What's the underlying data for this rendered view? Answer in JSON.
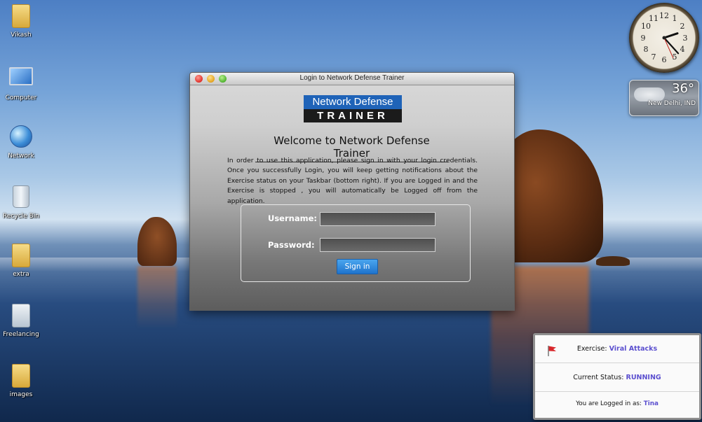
{
  "desktop": {
    "icons": [
      {
        "label": "Vikash",
        "icon": "user-folder-icon"
      },
      {
        "label": "Computer",
        "icon": "computer-icon"
      },
      {
        "label": "Network",
        "icon": "network-icon"
      },
      {
        "label": "Recycle Bin",
        "icon": "recycle-bin-icon"
      },
      {
        "label": "extra",
        "icon": "folder-icon"
      },
      {
        "label": "Freelancing",
        "icon": "folder-shortcut-icon"
      },
      {
        "label": "images",
        "icon": "folder-icon"
      }
    ]
  },
  "gadgets": {
    "clock": {
      "hours": 2,
      "minutes": 23,
      "seconds": 26
    },
    "weather": {
      "temperature": "36°",
      "city": "New Delhi, IND"
    }
  },
  "window": {
    "title": "Login to Network Defense Trainer",
    "logo": {
      "line1": "Network Defense",
      "line2": "TRAINER"
    },
    "welcome": "Welcome to Network Defense Trainer",
    "intro": "In order to use this application, please sign in with your login credentials. Once you successfully Login, you will keep getting notifications about the Exercise status on your Taskbar (bottom right). If you are Logged in and the Exercise is stopped , you will automatically be Logged off from the application.",
    "form": {
      "username_label": "Username:",
      "username_value": "",
      "password_label": "Password:",
      "password_value": "",
      "signin_label": "Sign in"
    }
  },
  "notification": {
    "exercise_label": "Exercise:",
    "exercise_value": "Viral Attacks",
    "status_label": "Current Status:",
    "status_value": "RUNNING",
    "login_label": "You are Logged in as:",
    "login_value": "Tina"
  },
  "colors": {
    "accent_blue": "#1f63b8",
    "signin_blue": "#2b86dc",
    "notify_accent": "#5b4fcf"
  }
}
